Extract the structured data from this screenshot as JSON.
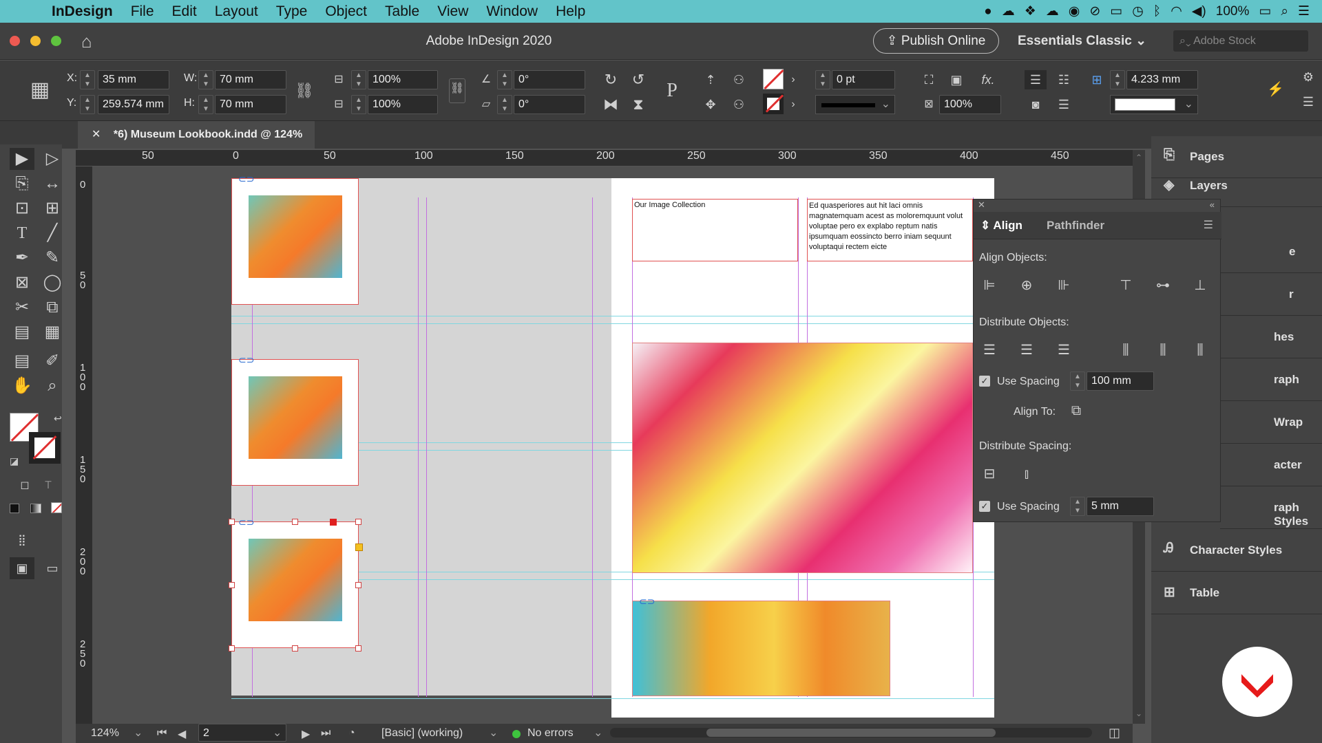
{
  "menubar": {
    "app_name": "InDesign",
    "items": [
      "File",
      "Edit",
      "Layout",
      "Type",
      "Object",
      "Table",
      "View",
      "Window",
      "Help"
    ],
    "battery": "100%"
  },
  "titlebar": {
    "title": "Adobe InDesign 2020",
    "publish": "Publish Online",
    "workspace": "Essentials Classic",
    "stock_placeholder": "Adobe Stock"
  },
  "control": {
    "x": "35 mm",
    "y": "259.574 mm",
    "w": "70 mm",
    "h": "70 mm",
    "scale_x": "100%",
    "scale_y": "100%",
    "rotate": "0°",
    "shear": "0°",
    "stroke_weight": "0 pt",
    "opacity": "100%",
    "gutter": "4.233 mm",
    "labels": {
      "x": "X:",
      "y": "Y:",
      "w": "W:",
      "h": "H:"
    }
  },
  "document": {
    "tab_title": "*6) Museum Lookbook.indd @ 124%",
    "text_frame_1": "Our Image Collection",
    "text_frame_2": "Ed quasperiores aut hit laci omnis magnatemquam acest as moloremquunt volut voluptae pero ex explabo reptum natis ipsumquam eossincto berro iniam sequunt voluptaqui rectem eicte"
  },
  "rulers": {
    "h": [
      "50",
      "0",
      "50",
      "100",
      "150",
      "200",
      "250",
      "300",
      "350",
      "400",
      "450"
    ],
    "v": [
      "0",
      "5 0",
      "1 0 0",
      "1 5 0",
      "2 0 0",
      "2 5 0"
    ]
  },
  "align_panel": {
    "tabs": [
      "Align",
      "Pathfinder"
    ],
    "align_objects": "Align Objects:",
    "distribute_objects": "Distribute Objects:",
    "use_spacing": "Use Spacing",
    "spacing_value_1": "100 mm",
    "align_to": "Align To:",
    "distribute_spacing": "Distribute Spacing:",
    "spacing_value_2": "5 mm"
  },
  "right_panels": [
    {
      "label": "Pages",
      "icon": "pages-icon"
    },
    {
      "label": "Layers",
      "icon": "layers-icon"
    },
    {
      "label": "e",
      "icon": ""
    },
    {
      "label": "r",
      "icon": ""
    },
    {
      "label": "hes",
      "icon": ""
    },
    {
      "label": "raph",
      "icon": ""
    },
    {
      "label": "Wrap",
      "icon": ""
    },
    {
      "label": "acter",
      "icon": ""
    },
    {
      "label": "raph Styles",
      "icon": ""
    },
    {
      "label": "Character Styles",
      "icon": "character-styles-icon"
    },
    {
      "label": "Table",
      "icon": "table-icon"
    }
  ],
  "statusbar": {
    "zoom": "124%",
    "page": "2",
    "style": "[Basic] (working)",
    "errors": "No errors"
  },
  "colors": {
    "menubar_bg": "#62c4c9",
    "accent_red": "#e03030",
    "guide_cyan": "#7fd6e0",
    "guide_magenta": "#c26ee0"
  }
}
